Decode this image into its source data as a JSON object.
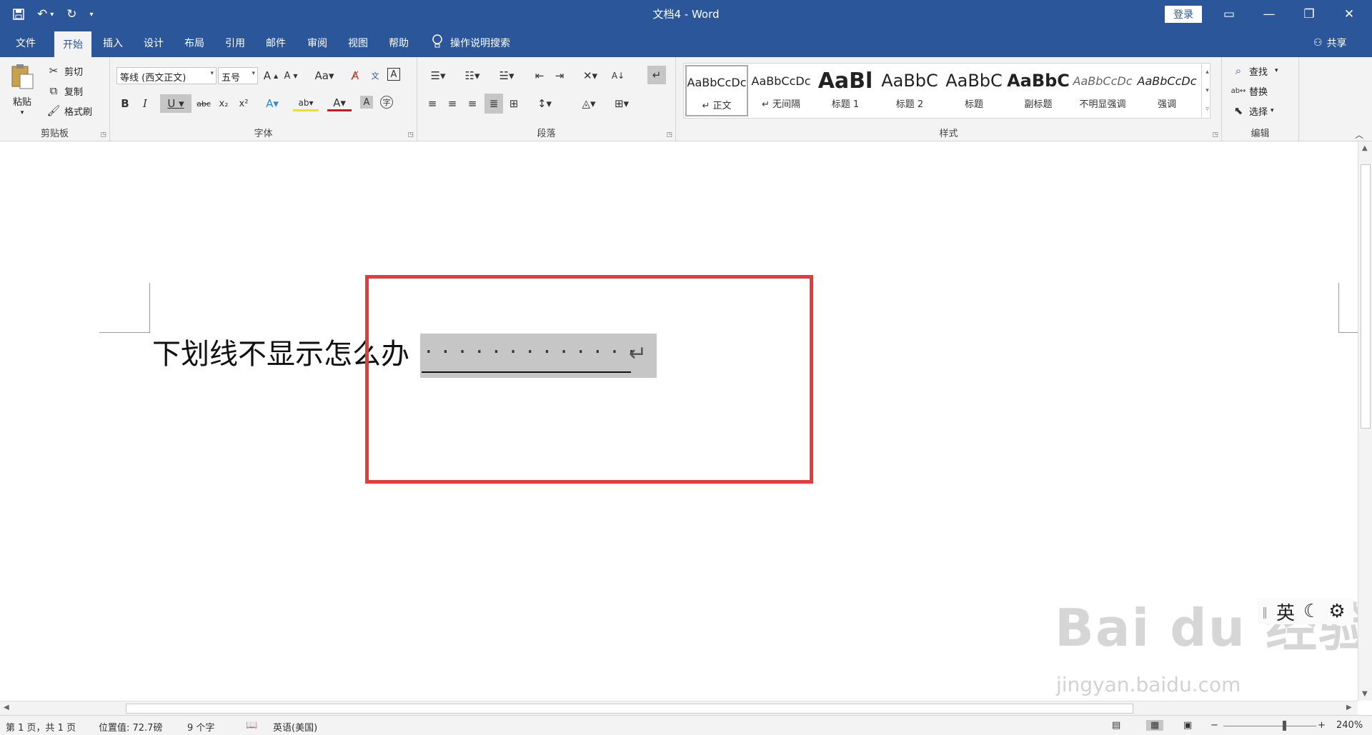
{
  "titlebar": {
    "title": "文档4 - Word",
    "login_label": "登录",
    "qat": {
      "save_icon": "save-icon",
      "undo_icon": "undo-icon",
      "redo_icon": "redo-icon"
    }
  },
  "menu": {
    "tabs": [
      "文件",
      "开始",
      "插入",
      "设计",
      "布局",
      "引用",
      "邮件",
      "审阅",
      "视图",
      "帮助"
    ],
    "active_tab": "开始",
    "tell_me": "操作说明搜索",
    "share": "共享"
  },
  "ribbon": {
    "clipboard": {
      "paste": "粘贴",
      "cut": "剪切",
      "copy": "复制",
      "format_painter": "格式刷",
      "label": "剪贴板"
    },
    "font": {
      "font_name": "等线 (西文正文)",
      "font_size": "五号",
      "label": "字体"
    },
    "paragraph": {
      "label": "段落"
    },
    "styles": {
      "label": "样式",
      "items": [
        {
          "sample": "AaBbCcDc",
          "name": "↵ 正文"
        },
        {
          "sample": "AaBbCcDc",
          "name": "↵ 无间隔"
        },
        {
          "sample": "AaBl",
          "name": "标题 1"
        },
        {
          "sample": "AaBbC",
          "name": "标题 2"
        },
        {
          "sample": "AaBbC",
          "name": "标题"
        },
        {
          "sample": "AaBbC",
          "name": "副标题"
        },
        {
          "sample": "AaBbCcDc",
          "name": "不明显强调"
        },
        {
          "sample": "AaBbCcDc",
          "name": "强调"
        }
      ]
    },
    "editing": {
      "find": "查找",
      "replace": "替换",
      "select": "选择",
      "label": "编辑"
    }
  },
  "document": {
    "text": "下划线不显示怎么办",
    "dots": "·············"
  },
  "ime": {
    "lang": "英"
  },
  "watermark": {
    "main": "Bai du 经验",
    "sub": "jingyan.baidu.com"
  },
  "status": {
    "page": "第 1 页，共 1 页",
    "position": "位置值: 72.7磅",
    "words": "9 个字",
    "language": "英语(美国)",
    "zoom": "240%"
  },
  "colors": {
    "brand": "#2b579a",
    "highlight_box": "#e63b3b",
    "selection": "#c6c6c6"
  }
}
